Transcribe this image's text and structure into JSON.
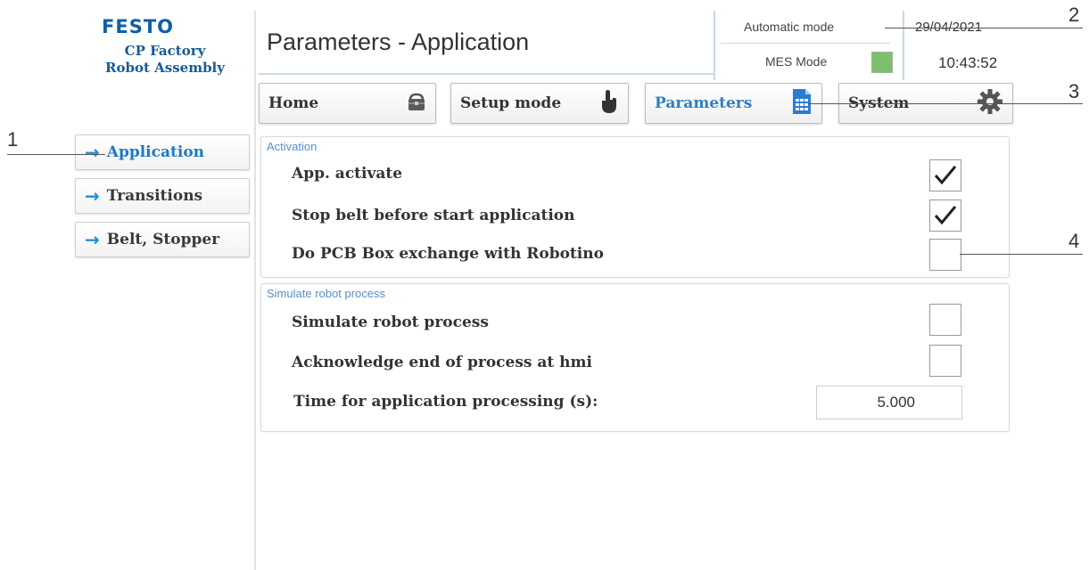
{
  "brand": {
    "logo": "FESTO",
    "station_line1": "CP Factory",
    "station_line2": "Robot Assembly"
  },
  "header": {
    "title": "Parameters - Application",
    "automatic_mode": "Automatic mode",
    "mes_mode": "MES Mode",
    "mes_led_color": "#7cc06b",
    "date": "29/04/2021",
    "time": "10:43:52"
  },
  "topnav": [
    {
      "label": "Home",
      "icon": "lock-box-icon"
    },
    {
      "label": "Setup mode",
      "icon": "hand-pointer-icon"
    },
    {
      "label": "Parameters",
      "icon": "spreadsheet-icon",
      "active": true
    },
    {
      "label": "System",
      "icon": "gear-icon"
    }
  ],
  "sidebar": {
    "items": [
      {
        "label": "Application",
        "active": true
      },
      {
        "label": "Transitions"
      },
      {
        "label": "Belt, Stopper"
      }
    ]
  },
  "activation": {
    "legend": "Activation",
    "rows": [
      {
        "label": "App. activate",
        "checked": true
      },
      {
        "label": "Stop belt before start application",
        "checked": true
      },
      {
        "label": "Do PCB Box exchange with Robotino",
        "checked": false
      }
    ]
  },
  "simulate": {
    "legend": "Simulate robot process",
    "rows": [
      {
        "label": "Simulate robot process",
        "checked": false
      },
      {
        "label": "Acknowledge end of process at hmi",
        "checked": false
      }
    ],
    "time_label": "Time for application processing (s):",
    "time_value": "5.000"
  },
  "callouts": [
    "1",
    "2",
    "3",
    "4"
  ],
  "colors": {
    "accent": "#1e79c4",
    "brand_blue": "#0f5fa8",
    "arrow": "#1e8fd8"
  }
}
